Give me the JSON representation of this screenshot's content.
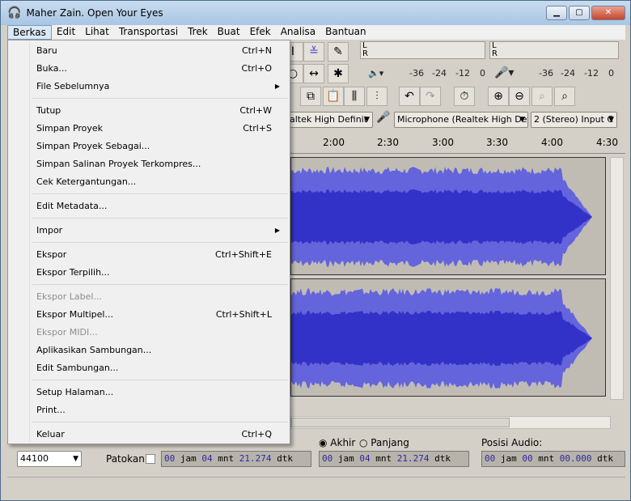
{
  "window": {
    "title": "Maher Zain. Open Your Eyes",
    "minimize": "▁",
    "maximize": "▢",
    "close": "✕"
  },
  "menubar": [
    "Berkas",
    "Edit",
    "Lihat",
    "Transportasi",
    "Trek",
    "Buat",
    "Efek",
    "Analisa",
    "Bantuan"
  ],
  "file_menu": [
    {
      "label": "Baru",
      "shortcut": "Ctrl+N"
    },
    {
      "label": "Buka...",
      "shortcut": "Ctrl+O"
    },
    {
      "label": "File Sebelumnya",
      "submenu": "▶"
    },
    {
      "sep": true
    },
    {
      "label": "Tutup",
      "shortcut": "Ctrl+W"
    },
    {
      "label": "Simpan Proyek",
      "shortcut": "Ctrl+S"
    },
    {
      "label": "Simpan Proyek Sebagai..."
    },
    {
      "label": "Simpan Salinan Proyek Terkompres..."
    },
    {
      "label": "Cek Ketergantungan..."
    },
    {
      "sep": true
    },
    {
      "label": "Edit Metadata..."
    },
    {
      "sep": true
    },
    {
      "label": "Impor",
      "submenu": "▶"
    },
    {
      "sep": true
    },
    {
      "label": "Ekspor",
      "shortcut": "Ctrl+Shift+E"
    },
    {
      "label": "Ekspor Terpilih..."
    },
    {
      "sep": true
    },
    {
      "label": "Ekspor Label...",
      "disabled": true
    },
    {
      "label": "Ekspor Multipel...",
      "shortcut": "Ctrl+Shift+L"
    },
    {
      "label": "Ekspor MIDI...",
      "disabled": true
    },
    {
      "label": "Aplikasikan Sambungan..."
    },
    {
      "label": "Edit Sambungan..."
    },
    {
      "sep": true
    },
    {
      "label": "Setup Halaman..."
    },
    {
      "label": "Print..."
    },
    {
      "sep": true
    },
    {
      "label": "Keluar",
      "shortcut": "Ctrl+Q"
    }
  ],
  "meters": {
    "playback_L": "L",
    "playback_R": "R",
    "record_L": "L",
    "record_R": "R",
    "scale": [
      "-36",
      "-24",
      "-12",
      "0"
    ]
  },
  "devices": {
    "output": "altek High Definit",
    "input": "Microphone (Realtek High Defi",
    "channels": "2 (Stereo) Input C"
  },
  "ruler": [
    "2:00",
    "2:30",
    "3:00",
    "3:30",
    "4:00",
    "4:30"
  ],
  "selection": {
    "rate": "44100",
    "snap_label": "Patokan",
    "end_label": "Akhir",
    "length_label": "Panjang",
    "audio_pos_label": "Posisi Audio:",
    "start": {
      "h": "00",
      "m": "04",
      "s": "21.274"
    },
    "end": {
      "h": "00",
      "m": "04",
      "s": "21.274"
    },
    "pos": {
      "h": "00",
      "m": "00",
      "s": "00.000"
    },
    "u_h": "jam",
    "u_m": "mnt",
    "u_s": "dtk"
  },
  "colors": {
    "wave": "#3232c8",
    "wave_light": "#6464dc",
    "track_bg": "#c0bcb4"
  }
}
